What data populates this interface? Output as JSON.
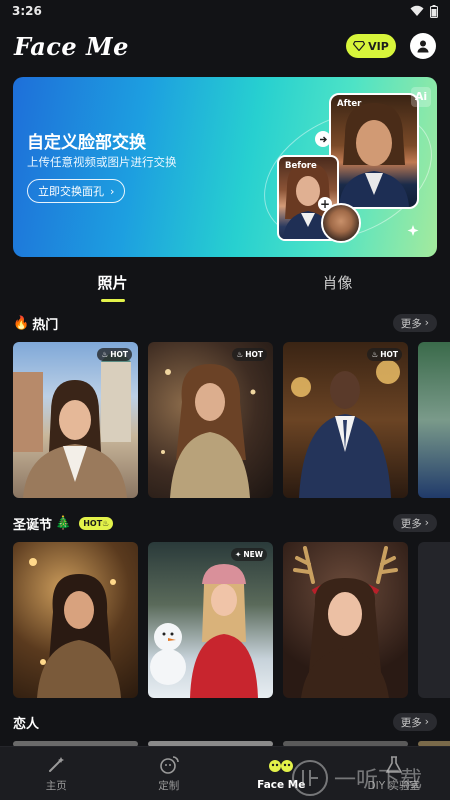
{
  "status_bar": {
    "time": "3:26"
  },
  "header": {
    "app_title": "Face Me",
    "vip_label": "VIP"
  },
  "banner": {
    "title": "自定义脸部交换",
    "subtitle": "上传任意视频或图片进行交换",
    "button_label": "立即交换面孔",
    "after_label": "After",
    "before_label": "Before",
    "ai_label": "Ai"
  },
  "tabs": [
    {
      "label": "照片",
      "active": true
    },
    {
      "label": "肖像",
      "active": false
    }
  ],
  "sections": {
    "hot": {
      "title": "热门",
      "more_label": "更多",
      "badges": [
        "HOT",
        "HOT",
        "HOT"
      ]
    },
    "christmas": {
      "title": "圣诞节",
      "hot_chip": "HOT",
      "more_label": "更多",
      "badges": [
        "NEW"
      ]
    },
    "lovers": {
      "title": "恋人",
      "more_label": "更多"
    }
  },
  "bottom_nav": [
    {
      "label": "主页",
      "icon": "wand-icon",
      "active": false
    },
    {
      "label": "定制",
      "icon": "swap-face-icon",
      "active": false
    },
    {
      "label": "Face Me",
      "icon": "faceme-icon",
      "active": true
    },
    {
      "label": "DIY 实验室",
      "icon": "flask-icon",
      "active": false
    }
  ],
  "watermark": {
    "text": "一听下载"
  },
  "colors": {
    "accent": "#e3f24a",
    "background": "#121316",
    "nav_bg": "#1c1d21"
  }
}
